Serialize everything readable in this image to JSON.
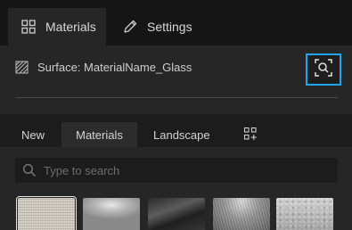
{
  "top_tabs": {
    "materials_label": "Materials",
    "settings_label": "Settings",
    "materials_icon": "grid-icon",
    "settings_icon": "pencil-icon"
  },
  "surface": {
    "label": "Surface: MaterialName_Glass",
    "icon": "hatch-icon",
    "picker_icon": "search-focus-icon"
  },
  "sub_tabs": {
    "new_label": "New",
    "materials_label": "Materials",
    "landscape_label": "Landscape",
    "more_icon": "grid-plus-icon"
  },
  "search": {
    "placeholder": "Type to search",
    "value": ""
  },
  "thumbnails": [
    {
      "name": "fabric",
      "selected": true
    },
    {
      "name": "brushed-gray",
      "selected": false
    },
    {
      "name": "dark-metal",
      "selected": false
    },
    {
      "name": "brushed-metal",
      "selected": false
    },
    {
      "name": "concrete",
      "selected": false
    }
  ],
  "colors": {
    "accent": "#1ea5ea",
    "background": "#1d1d1d",
    "panel": "#262626"
  }
}
